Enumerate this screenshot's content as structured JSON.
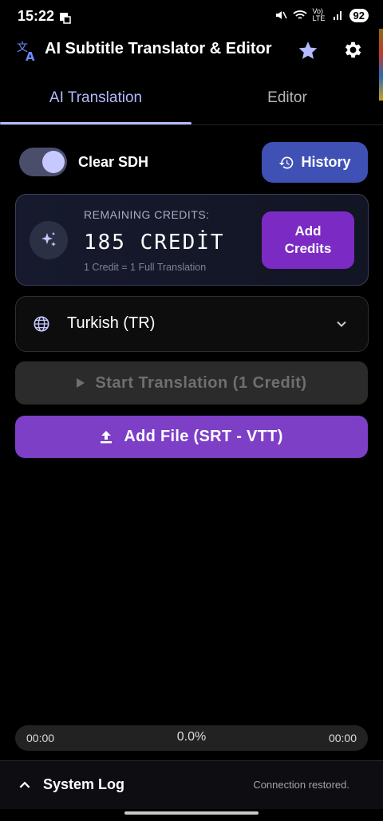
{
  "status_bar": {
    "time": "15:22",
    "signal_text": "Vo) LTE",
    "battery": "92"
  },
  "app": {
    "title": "AI Subtitle Translator & Editor"
  },
  "tabs": [
    {
      "label": "AI Translation",
      "active": true
    },
    {
      "label": "Editor",
      "active": false
    }
  ],
  "options": {
    "clear_sdh_label": "Clear SDH",
    "clear_sdh_on": true,
    "history_label": "History"
  },
  "credits": {
    "heading": "REMAINING CREDITS:",
    "value": "185 CREDİT",
    "note": "1 Credit = 1 Full Translation",
    "add_label": "Add Credits"
  },
  "language": {
    "selected": "Turkish (TR)"
  },
  "actions": {
    "start_label": "Start Translation (1 Credit)",
    "add_file_label": "Add File (SRT - VTT)"
  },
  "progress": {
    "elapsed": "00:00",
    "percent": "0.0%",
    "remaining": "00:00"
  },
  "system_log": {
    "title": "System Log",
    "status": "Connection restored."
  },
  "colors": {
    "accent": "#b4baff",
    "primary_button": "#3f51b5",
    "purple": "#7c3fc6",
    "background": "#000000"
  }
}
